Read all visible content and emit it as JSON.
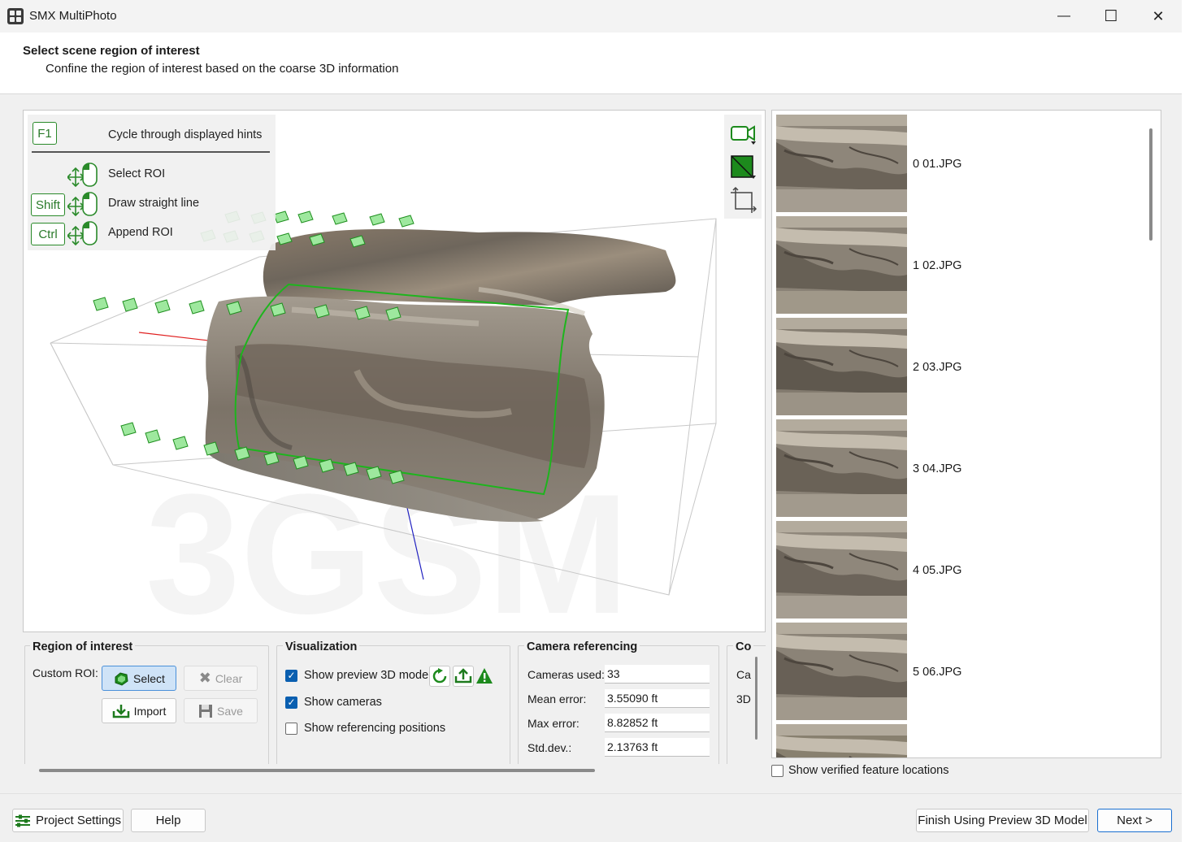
{
  "window": {
    "title": "SMX MultiPhoto",
    "minimize": "—",
    "maximize": "☐",
    "close": "✕"
  },
  "header": {
    "title": "Select scene region of interest",
    "subtitle": "Confine the region of interest based on the coarse 3D information"
  },
  "hints": {
    "f1_key": "F1",
    "f1_text": "Cycle through displayed hints",
    "select_text": "Select ROI",
    "shift_key": "Shift",
    "shift_text": "Draw straight line",
    "ctrl_key": "Ctrl",
    "ctrl_text": "Append ROI"
  },
  "viewport": {
    "watermark": "3GSM",
    "roi_color": "#1db51d",
    "camera_color": "#2fc42f"
  },
  "thumbnails": [
    {
      "label": "0 01.JPG"
    },
    {
      "label": "1 02.JPG"
    },
    {
      "label": "2 03.JPG"
    },
    {
      "label": "3 04.JPG"
    },
    {
      "label": "4 05.JPG"
    },
    {
      "label": "5 06.JPG"
    },
    {
      "label": ""
    }
  ],
  "verified": {
    "label": "Show verified feature locations",
    "checked": false
  },
  "roi": {
    "title": "Region of interest",
    "custom_label": "Custom ROI:",
    "select": "Select",
    "clear": "Clear",
    "import": "Import",
    "save": "Save"
  },
  "visualization": {
    "title": "Visualization",
    "show_preview": "Show preview 3D model",
    "show_cameras": "Show cameras",
    "show_referencing": "Show referencing positions"
  },
  "camera_ref": {
    "title": "Camera referencing",
    "rows": [
      {
        "label": "Cameras used:",
        "value": "33"
      },
      {
        "label": "Mean error:",
        "value": "3.55090 ft"
      },
      {
        "label": "Max error:",
        "value": "8.82852 ft"
      },
      {
        "label": "Std.dev.:",
        "value": "2.13763 ft"
      }
    ]
  },
  "partial_group": {
    "title": "Co",
    "line1": "Ca",
    "line2": "3D"
  },
  "footer": {
    "project_settings": "Project Settings",
    "help": "Help",
    "finish": "Finish Using Preview 3D Model",
    "next": "Next >"
  }
}
